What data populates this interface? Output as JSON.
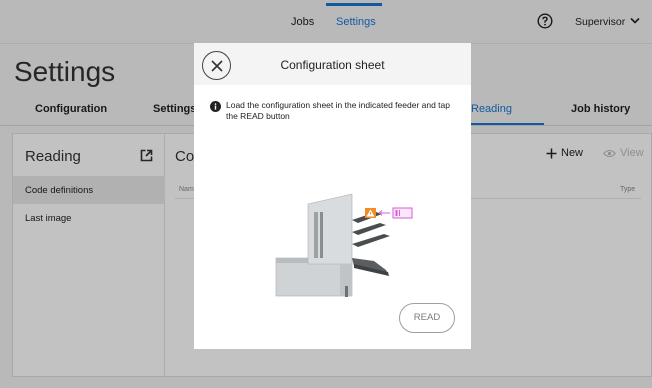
{
  "topbar": {
    "nav": [
      {
        "label": "Jobs"
      },
      {
        "label": "Settings"
      }
    ],
    "help_icon": "question-circle-icon",
    "user_label": "Supervisor",
    "user_icon": "chevron-down-icon"
  },
  "page": {
    "title": "Settings"
  },
  "tabs": [
    {
      "label": "Configuration"
    },
    {
      "label": "Settings"
    },
    {
      "label": "Reading",
      "active": true
    },
    {
      "label": "Job history"
    }
  ],
  "sidebar": {
    "title": "Reading",
    "icon": "external-link-icon",
    "items": [
      {
        "label": "Code definitions",
        "selected": true
      },
      {
        "label": "Last image"
      }
    ]
  },
  "content": {
    "title": "Co",
    "columns": [
      {
        "label": "Nam"
      },
      {
        "label": "Type"
      }
    ],
    "actions": {
      "new_label": "New",
      "view_label": "View"
    }
  },
  "modal": {
    "title": "Configuration sheet",
    "message": "Load the configuration sheet in the indicated feeder and tap the READ button",
    "read_label": "READ",
    "close_icon": "close-icon",
    "info_icon": "info-icon",
    "warning_icon": "warning-triangle-icon"
  },
  "colors": {
    "accent": "#1976d2",
    "warning": "#f28c28",
    "feeder_highlight": "#d65fd0",
    "overlay": "rgba(0,0,0,0.24)"
  }
}
